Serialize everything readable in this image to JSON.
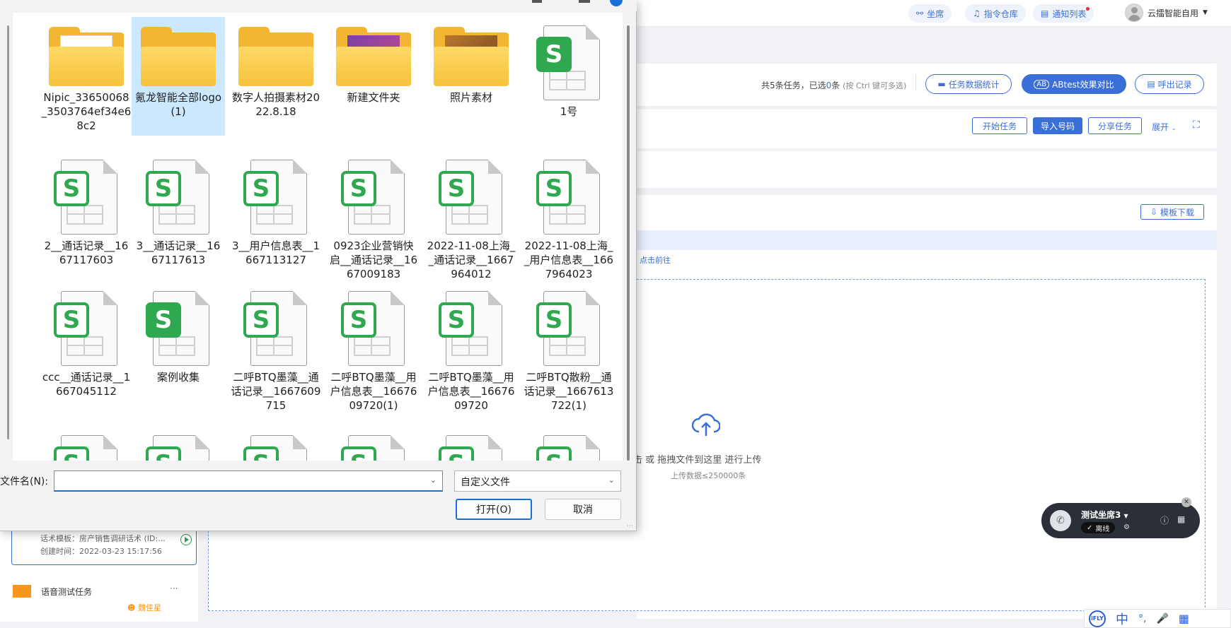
{
  "topbar": {
    "seat_label": "坐席",
    "command_label": "指令仓库",
    "notify_label": "通知列表",
    "user_name": "云擂智能自用"
  },
  "task_bar": {
    "summary_prefix": "共5条任务，已选",
    "selected_count": "0",
    "summary_suffix": "条",
    "hint": "(按 Ctrl 键可多选)",
    "stats_button": "任务数据统计",
    "abtest_button": "ABtest效果对比",
    "ab_icon": "AB",
    "export_button": "呼出记录"
  },
  "action_bar": {
    "start_button": "开始任务",
    "import_button": "导入号码",
    "share_button": "分享任务",
    "expand_button": "展开"
  },
  "template_download": "模板下载",
  "goto_link": "点击前往",
  "left_list": {
    "card1_script": "话术模板：房产销售调研话术 (ID:...",
    "card1_created": "创建时间：2022-03-23 15:17:56",
    "card2_name": "语音测试任务",
    "card2_more": "···",
    "card2_owner": "魏佳星"
  },
  "upload": {
    "text": "击 或 拖拽文件到这里 进行上传",
    "limit": "上传数据≤250000条"
  },
  "softphone": {
    "name": "测试坐席3",
    "status": "离线"
  },
  "ime": {
    "logo": "iFLY",
    "lang": "中"
  },
  "dialog": {
    "files": [
      {
        "name": "Nipic_33650068_3503764ef34e68c2",
        "kind": "folder-doc"
      },
      {
        "name": "氪龙智能全部logo(1)",
        "kind": "folder",
        "selected": true
      },
      {
        "name": "数字人拍摄素材2022.8.18",
        "kind": "folder"
      },
      {
        "name": "新建文件夹",
        "kind": "folder-pic-purple"
      },
      {
        "name": "照片素材",
        "kind": "folder-pic-photo"
      },
      {
        "name": "1号",
        "kind": "sheet-solid"
      },
      {
        "name": "2__通话记录__1667117603",
        "kind": "sheet"
      },
      {
        "name": "3__通话记录__1667117613",
        "kind": "sheet"
      },
      {
        "name": "3__用户信息表__1667113127",
        "kind": "sheet"
      },
      {
        "name": "0923企业营销快启__通话记录__1667009183",
        "kind": "sheet"
      },
      {
        "name": "2022-11-08上海__通话记录__1667964012",
        "kind": "sheet"
      },
      {
        "name": "2022-11-08上海__用户信息表__1667964023",
        "kind": "sheet"
      },
      {
        "name": "ccc__通话记录__1667045112",
        "kind": "sheet"
      },
      {
        "name": "案例收集",
        "kind": "sheet-solid"
      },
      {
        "name": "二呼BTQ墨藻__通话记录__1667609715",
        "kind": "sheet"
      },
      {
        "name": "二呼BTQ墨藻__用户信息表__1667609720(1)",
        "kind": "sheet"
      },
      {
        "name": "二呼BTQ墨藻__用户信息表__1667609720",
        "kind": "sheet"
      },
      {
        "name": "二呼BTQ散粉__通话记录__1667613722(1)",
        "kind": "sheet"
      },
      {
        "name": "",
        "kind": "sheet"
      },
      {
        "name": "",
        "kind": "sheet"
      },
      {
        "name": "",
        "kind": "sheet"
      },
      {
        "name": "",
        "kind": "sheet"
      },
      {
        "name": "",
        "kind": "sheet"
      },
      {
        "name": "",
        "kind": "sheet"
      }
    ],
    "filename_label": "文件名(N):",
    "filename_value": "",
    "filter_value": "自定义文件",
    "open_button": "打开(O)",
    "cancel_button": "取消"
  },
  "colors": {
    "accent": "#3b6fd8",
    "sheet_green": "#2fa84f",
    "folder_yellow": "#f5c23c",
    "selection": "#cce8ff"
  }
}
